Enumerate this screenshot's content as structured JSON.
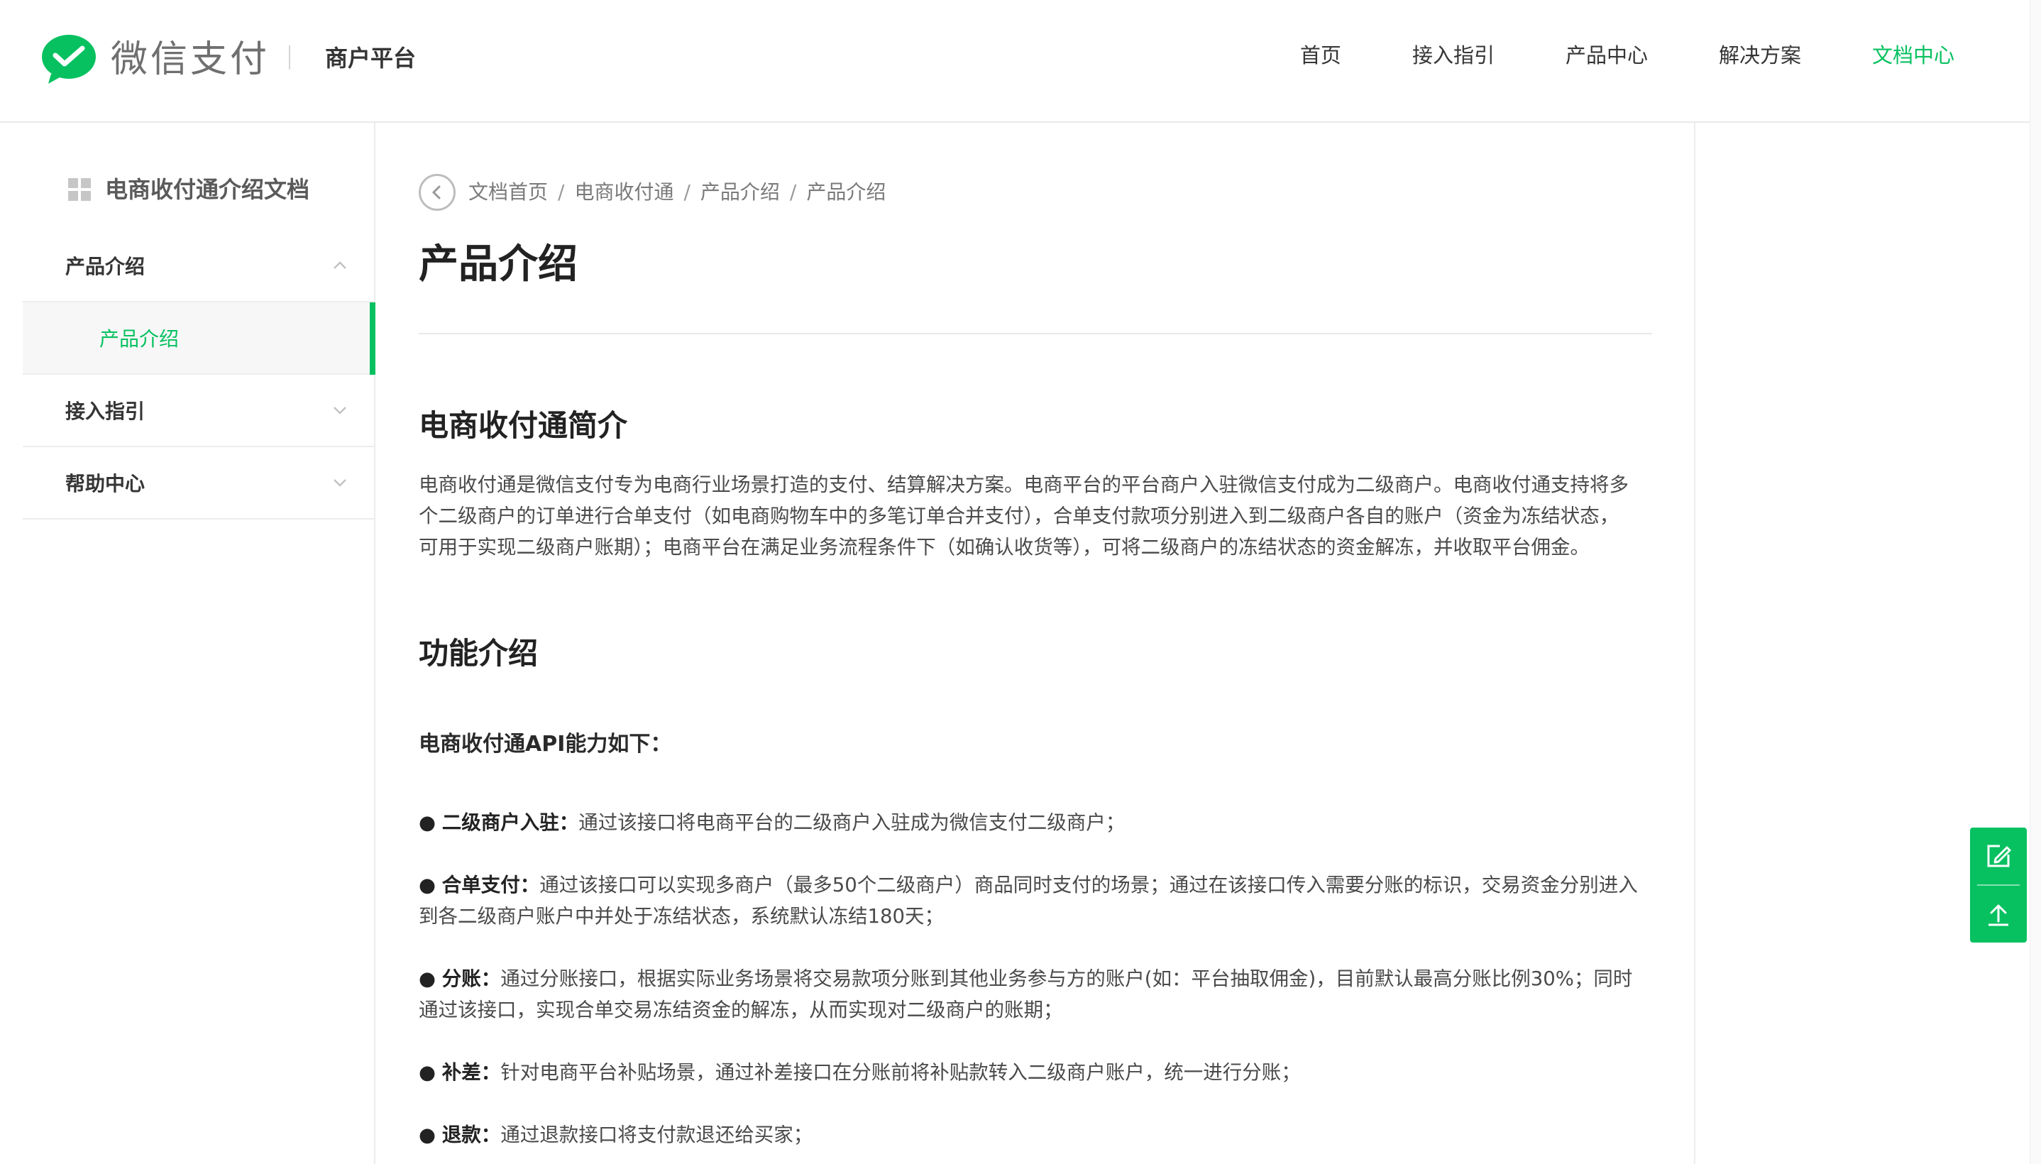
{
  "header": {
    "logo_text": "微信支付",
    "platform": "商户平台",
    "nav": [
      {
        "label": "首页"
      },
      {
        "label": "接入指引"
      },
      {
        "label": "产品中心"
      },
      {
        "label": "解决方案"
      },
      {
        "label": "文档中心",
        "active": true
      }
    ],
    "accent_color": "#07c160"
  },
  "sidebar": {
    "title": "电商收付通介绍文档",
    "title_icon": "grid-icon",
    "items": [
      {
        "label": "产品介绍",
        "expanded": true,
        "icon": "chevron-up-icon",
        "children": [
          {
            "label": "产品介绍",
            "active": true
          }
        ]
      },
      {
        "label": "接入指引",
        "expanded": false,
        "icon": "chevron-down-icon"
      },
      {
        "label": "帮助中心",
        "expanded": false,
        "icon": "chevron-down-icon"
      }
    ]
  },
  "breadcrumb": {
    "back_icon": "back-arrow-icon",
    "items": [
      "文档首页",
      "电商收付通",
      "产品介绍",
      "产品介绍"
    ],
    "separator": "/"
  },
  "content": {
    "title": "产品介绍",
    "section1": {
      "heading": "电商收付通简介",
      "lines": [
        "电商收付通是微信支付专为电商行业场景打造的支付、结算解决方案。电商平台的平台商户入驻微信支付成为二级商户。电商收付通支持将多",
        "个二级商户的订单进行合单支付（如电商购物车中的多笔订单合并支付），合单支付款项分别进入到二级商户各自的账户（资金为冻结状态，",
        "可用于实现二级商户账期）；电商平台在满足业务流程条件下（如确认收货等），可将二级商户的冻结状态的资金解冻，并收取平台佣金。"
      ]
    },
    "section2": {
      "heading": "功能介绍",
      "subheading": "电商收付通API能力如下：",
      "bullets": [
        {
          "title": "二级商户入驻：",
          "lines": [
            "通过该接口将电商平台的二级商户入驻成为微信支付二级商户；"
          ]
        },
        {
          "title": "合单支付：",
          "lines": [
            "通过该接口可以实现多商户（最多50个二级商户）商品同时支付的场景；通过在该接口传入需要分账的标识，交易资金分别进入",
            "到各二级商户账户中并处于冻结状态，系统默认冻结180天；"
          ]
        },
        {
          "title": "分账：",
          "lines": [
            "通过分账接口，根据实际业务场景将交易款项分账到其他业务参与方的账户(如：平台抽取佣金)，目前默认最高分账比例30%；同时",
            "通过该接口，实现合单交易冻结资金的解冻，从而实现对二级商户的账期；"
          ]
        },
        {
          "title": "补差：",
          "lines": [
            "针对电商平台补贴场景，通过补差接口在分账前将补贴款转入二级商户账户，统一进行分账；"
          ]
        },
        {
          "title": "退款：",
          "lines": [
            "通过退款接口将支付款退还给买家；"
          ]
        }
      ]
    }
  },
  "floating_tools": [
    {
      "icon": "edit-icon"
    },
    {
      "icon": "back-to-top-icon"
    }
  ]
}
